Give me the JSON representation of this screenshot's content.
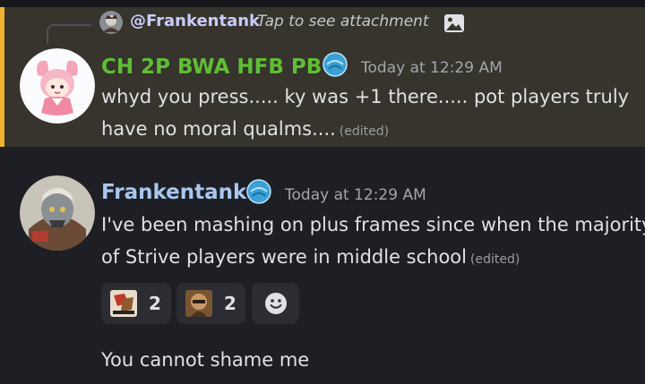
{
  "reply": {
    "author": "@Frankentank",
    "note": "Tap to see attachment",
    "attachment_icon": "image-icon"
  },
  "message1": {
    "author": "CH 2P BWA HFB PB",
    "author_color": "#5fbd36",
    "timestamp": "Today at 12:29 AM",
    "line1": "whyd you press..... ky was +1 there..... pot players truly",
    "line2": "have no moral qualms....",
    "edited": "(edited)",
    "highlight_color": "#f0b232"
  },
  "message2": {
    "author": "Frankentank",
    "author_color": "#a9c6ee",
    "timestamp": "Today at 12:29 AM",
    "line1": "I've been mashing on plus frames since when the majority",
    "line2": "of Strive players were in middle school",
    "edited": "(edited)",
    "reactions": [
      {
        "emoji": "sticker-emoji-1",
        "count": "2"
      },
      {
        "emoji": "sticker-emoji-2",
        "count": "2"
      }
    ],
    "add_reaction_icon": "add-reaction-icon"
  },
  "message3": {
    "text": "You cannot shame me"
  }
}
